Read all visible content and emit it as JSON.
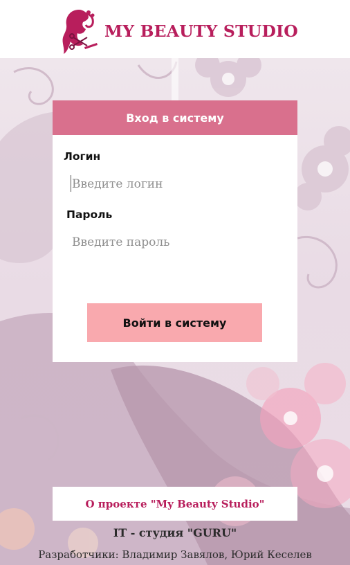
{
  "app": {
    "title": "MY BEAUTY STUDIO",
    "logo_icon": "woman-silhouette-with-scissors-icon",
    "brand_color": "#b81e5c"
  },
  "login_card": {
    "header": "Вход в систему",
    "header_color": "#d9708d",
    "login_label": "Логин",
    "login_placeholder": "Введите логин",
    "login_value": "",
    "password_label": "Пароль",
    "password_placeholder": "Введите пароль",
    "password_value": "",
    "submit_label": "Войти в систему",
    "submit_color": "#f9a9ae"
  },
  "footer": {
    "about_link": "О проекте \"My Beauty Studio\"",
    "studio": "IT - студия \"GURU\"",
    "developers": "Разработчики: Владимир Завялов, Юрий Кеселев"
  },
  "background": {
    "image": "floral-woman-silhouette",
    "tint": "#efe6ec"
  }
}
